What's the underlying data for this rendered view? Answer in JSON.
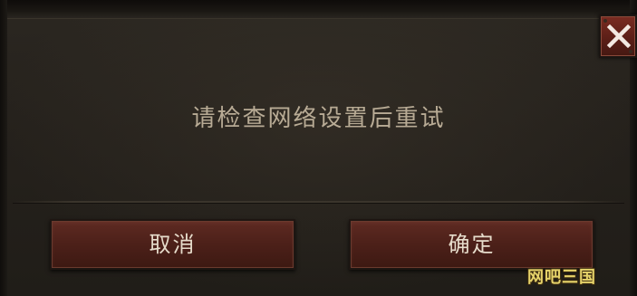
{
  "dialog": {
    "message": "请检查网络设置后重试",
    "close_icon": "close-icon",
    "buttons": {
      "cancel_label": "取消",
      "confirm_label": "确定"
    }
  },
  "watermark": {
    "text": "网吧三国"
  },
  "colors": {
    "panel_background": "#25211c",
    "message_text": "#b8ab95",
    "button_background": "#4c2019",
    "button_text": "#e6dccb",
    "close_background": "#5c1f17",
    "watermark_text": "#e6d36a"
  }
}
